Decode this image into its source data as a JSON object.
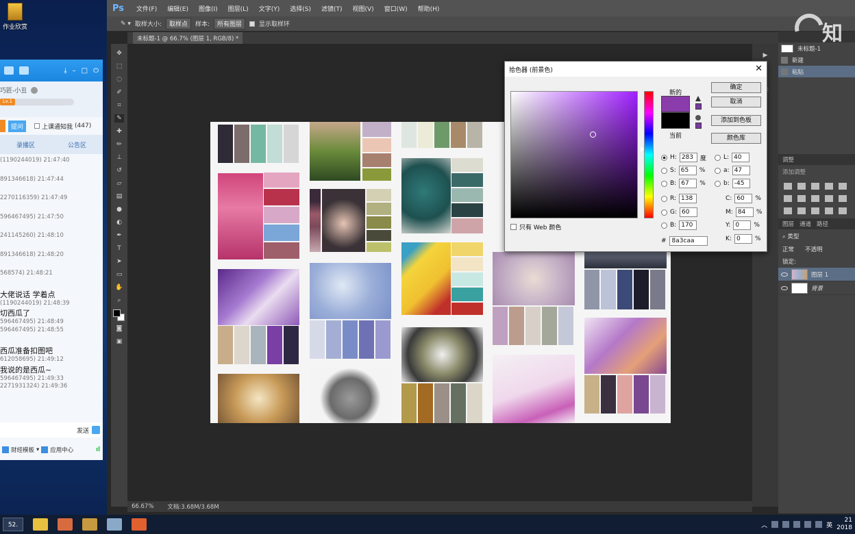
{
  "desktop": {
    "icon_label": "作业欣赏"
  },
  "chat": {
    "username": "巧匠-小丑",
    "level": "Lv.1",
    "reply_button": "提问",
    "notify_label": "上课通知我",
    "notify_count": "(447)",
    "tabs": [
      "录播区",
      "公告区"
    ],
    "messages": [
      {
        "meta": "(1190244019) 21:47:40",
        "text": ""
      },
      {
        "meta": "891346618) 21:47:44",
        "text": ""
      },
      {
        "meta": "2270116359) 21:47:49",
        "text": ""
      },
      {
        "meta": "596467495) 21:47:50",
        "text": ""
      },
      {
        "meta": "241145260) 21:48:10",
        "text": ""
      },
      {
        "meta": "891346618) 21:48:20",
        "text": ""
      },
      {
        "meta": "568574) 21:48:21",
        "text": ""
      },
      {
        "meta": "(1190244019) 21:48:39",
        "text": "大佬说话  学着点"
      },
      {
        "meta": "596467495) 21:48:49",
        "text": "切西瓜了"
      },
      {
        "meta": "596467495) 21:48:55",
        "text": ""
      },
      {
        "meta": "612058695) 21:49:12",
        "text": "西瓜准备扣图吧"
      },
      {
        "meta": "596467495) 21:49:33",
        "text": "我说的是西瓜~"
      },
      {
        "meta": "2271931324) 21:49:36",
        "text": ""
      }
    ],
    "send_label": "发送",
    "footer": {
      "finance": "财经模板",
      "app_center": "应用中心"
    }
  },
  "ps": {
    "logo": "Ps",
    "menu": [
      "文件(F)",
      "编辑(E)",
      "图像(I)",
      "图层(L)",
      "文字(Y)",
      "选择(S)",
      "滤镜(T)",
      "视图(V)",
      "窗口(W)",
      "帮助(H)"
    ],
    "options": {
      "sample_size_label": "取样大小:",
      "sample_size_value": "取样点",
      "sample_label": "样本:",
      "sample_value": "所有图层",
      "show_ring_label": "显示取样环"
    },
    "doc_tab": "未标题-1 @ 66.7% (图层 1, RGB/8) *",
    "status": {
      "zoom": "66.67%",
      "doc": "文档:3.68M/3.68M"
    },
    "history": {
      "doc": "未标题-1",
      "items": [
        "新建",
        "粘贴"
      ]
    },
    "adjust": {
      "title": "调整",
      "add": "添加调整"
    },
    "layers": {
      "tabs": [
        "图层",
        "通道",
        "路径"
      ],
      "kind": "类型",
      "mode": "正常",
      "opacity": "不透明",
      "lock": "锁定:",
      "rows": [
        {
          "name": "图层 1",
          "selected": true
        },
        {
          "name": "背景",
          "selected": false
        }
      ]
    }
  },
  "picker": {
    "title": "拾色器 (前景色)",
    "new_label": "新的",
    "current_label": "当前",
    "buttons": [
      "确定",
      "取消",
      "添加到色板",
      "颜色库"
    ],
    "web_only": "只有 Web 颜色",
    "new_color": "#8a3caa",
    "current_color": "#000000",
    "hsb": [
      {
        "k": "H:",
        "v": "283",
        "u": "度",
        "selected": true
      },
      {
        "k": "S:",
        "v": "65",
        "u": "%",
        "selected": false
      },
      {
        "k": "B:",
        "v": "67",
        "u": "%",
        "selected": false
      }
    ],
    "rgb": [
      {
        "k": "R:",
        "v": "138"
      },
      {
        "k": "G:",
        "v": "60"
      },
      {
        "k": "B:",
        "v": "170"
      }
    ],
    "lab": [
      {
        "k": "L:",
        "v": "40"
      },
      {
        "k": "a:",
        "v": "47"
      },
      {
        "k": "b:",
        "v": "-45"
      }
    ],
    "cmyk": [
      {
        "k": "C:",
        "v": "60",
        "u": "%"
      },
      {
        "k": "M:",
        "v": "84",
        "u": "%"
      },
      {
        "k": "Y:",
        "v": "0",
        "u": "%"
      },
      {
        "k": "K:",
        "v": "0",
        "u": "%"
      }
    ],
    "hex_label": "#",
    "hex": "8a3caa"
  },
  "watermark": "知",
  "taskbar": {
    "start": "52.",
    "clock_time": "21",
    "clock_date": "2018",
    "ime": "英"
  }
}
